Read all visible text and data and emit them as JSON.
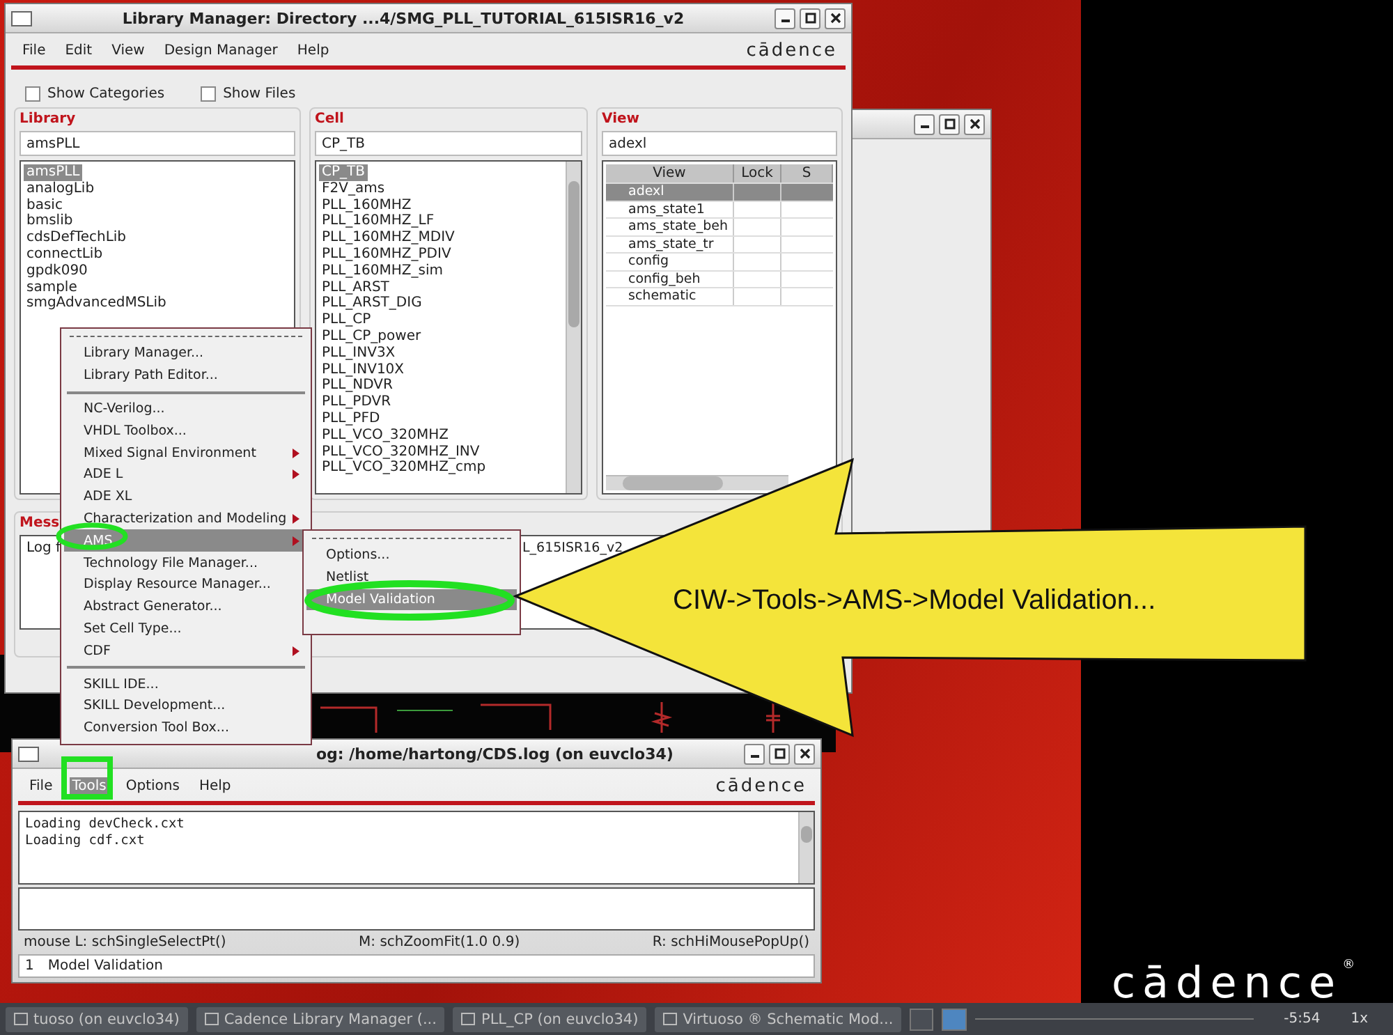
{
  "library_manager": {
    "title": "Library Manager: Directory ...4/SMG_PLL_TUTORIAL_615ISR16_v2",
    "menus": [
      "File",
      "Edit",
      "View",
      "Design Manager",
      "Help"
    ],
    "logo": "cādence",
    "options": [
      {
        "label": "Show Categories",
        "checked": false
      },
      {
        "label": "Show Files",
        "checked": false
      }
    ],
    "library": {
      "label": "Library",
      "value": "amsPLL",
      "items": [
        {
          "label": "amsPLL",
          "selected": true
        },
        {
          "label": "analogLib",
          "selected": false
        },
        {
          "label": "basic",
          "selected": false
        },
        {
          "label": "bmslib",
          "selected": false
        },
        {
          "label": "cdsDefTechLib",
          "selected": false
        },
        {
          "label": "connectLib",
          "selected": false
        },
        {
          "label": "gpdk090",
          "selected": false
        },
        {
          "label": "sample",
          "selected": false
        },
        {
          "label": "smgAdvancedMSLib",
          "selected": false
        }
      ]
    },
    "cell": {
      "label": "Cell",
      "value": "CP_TB",
      "items": [
        {
          "label": "CP_TB",
          "selected": true
        },
        {
          "label": "F2V_ams",
          "selected": false
        },
        {
          "label": "PLL_160MHZ",
          "selected": false
        },
        {
          "label": "PLL_160MHZ_LF",
          "selected": false
        },
        {
          "label": "PLL_160MHZ_MDIV",
          "selected": false
        },
        {
          "label": "PLL_160MHZ_PDIV",
          "selected": false
        },
        {
          "label": "PLL_160MHZ_sim",
          "selected": false
        },
        {
          "label": "PLL_ARST",
          "selected": false
        },
        {
          "label": "PLL_ARST_DIG",
          "selected": false
        },
        {
          "label": "PLL_CP",
          "selected": false
        },
        {
          "label": "PLL_CP_power",
          "selected": false
        },
        {
          "label": "PLL_INV3X",
          "selected": false
        },
        {
          "label": "PLL_INV10X",
          "selected": false
        },
        {
          "label": "PLL_NDVR",
          "selected": false
        },
        {
          "label": "PLL_PDVR",
          "selected": false
        },
        {
          "label": "PLL_PFD",
          "selected": false
        },
        {
          "label": "PLL_VCO_320MHZ",
          "selected": false
        },
        {
          "label": "PLL_VCO_320MHZ_INV",
          "selected": false
        },
        {
          "label": "PLL_VCO_320MHZ_cmp",
          "selected": false
        }
      ]
    },
    "view": {
      "label": "View",
      "value": "adexl",
      "columns": [
        "View",
        "Lock",
        "S"
      ],
      "rows": [
        {
          "name": "adexl",
          "selected": true
        },
        {
          "name": "ams_state1",
          "selected": false
        },
        {
          "name": "ams_state_beh",
          "selected": false
        },
        {
          "name": "ams_state_tr",
          "selected": false
        },
        {
          "name": "config",
          "selected": false
        },
        {
          "name": "config_beh",
          "selected": false
        },
        {
          "name": "schematic",
          "selected": false
        }
      ]
    },
    "messages": {
      "label": "Mess",
      "log_start": "Log f",
      "log_end": "L_615ISR16_v2"
    }
  },
  "tools_menu": [
    {
      "kind": "item",
      "label": "Library Manager...",
      "submenu": false,
      "selected": false
    },
    {
      "kind": "item",
      "label": "Library Path Editor...",
      "submenu": false,
      "selected": false
    },
    {
      "kind": "separator"
    },
    {
      "kind": "item",
      "label": "NC-Verilog...",
      "submenu": false,
      "selected": false
    },
    {
      "kind": "item",
      "label": "VHDL Toolbox...",
      "submenu": false,
      "selected": false
    },
    {
      "kind": "item",
      "label": "Mixed Signal Environment",
      "submenu": true,
      "selected": false
    },
    {
      "kind": "item",
      "label": "ADE L",
      "submenu": true,
      "selected": false
    },
    {
      "kind": "item",
      "label": "ADE XL",
      "submenu": false,
      "selected": false
    },
    {
      "kind": "item",
      "label": "Characterization and Modeling",
      "submenu": true,
      "selected": false
    },
    {
      "kind": "item",
      "label": "AMS",
      "submenu": true,
      "selected": true
    },
    {
      "kind": "item",
      "label": "Technology File Manager...",
      "submenu": false,
      "selected": false
    },
    {
      "kind": "item",
      "label": "Display Resource Manager...",
      "submenu": false,
      "selected": false
    },
    {
      "kind": "item",
      "label": "Abstract Generator...",
      "submenu": false,
      "selected": false
    },
    {
      "kind": "item",
      "label": "Set Cell Type...",
      "submenu": false,
      "selected": false
    },
    {
      "kind": "item",
      "label": "CDF",
      "submenu": true,
      "selected": false
    },
    {
      "kind": "separator"
    },
    {
      "kind": "item",
      "label": "SKILL IDE...",
      "submenu": false,
      "selected": false
    },
    {
      "kind": "item",
      "label": "SKILL Development...",
      "submenu": false,
      "selected": false
    },
    {
      "kind": "item",
      "label": "Conversion Tool Box...",
      "submenu": false,
      "selected": false
    }
  ],
  "ams_submenu": [
    {
      "label": "Options...",
      "selected": false
    },
    {
      "label": "Netlist",
      "selected": false
    },
    {
      "label": "Model Validation",
      "selected": true
    }
  ],
  "ciw": {
    "title": "og: /home/hartong/CDS.log (on euvclo34)",
    "menus": [
      {
        "label": "File",
        "selected": false
      },
      {
        "label": "Tools",
        "selected": true
      },
      {
        "label": "Options",
        "selected": false
      },
      {
        "label": "Help",
        "selected": false
      }
    ],
    "logo": "cādence",
    "log": [
      "Loading devCheck.cxt",
      "Loading cdf.cxt"
    ],
    "mouse": {
      "left": "mouse L: schSingleSelectPt()",
      "middle": "M: schZoomFit(1.0 0.9)",
      "right": "R: schHiMousePopUp()"
    },
    "prompt": {
      "number": "1",
      "text": "Model Validation"
    }
  },
  "callout": "CIW->Tools->AMS->Model Validation...",
  "taskbar": [
    "tuoso (on euvclo34)",
    "Cadence Library Manager (...",
    "PLL_CP (on euvclo34)",
    "Virtuoso ® Schematic Mod..."
  ],
  "player": {
    "time": "-5:54",
    "speed": "1x"
  },
  "brand": {
    "logo": "cādence",
    "mark": "®"
  }
}
